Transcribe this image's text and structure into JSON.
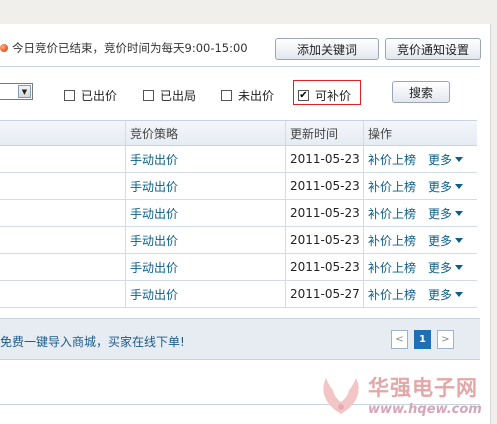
{
  "notice": {
    "text": "今日竞价已结束，竞价时间为每天9:00-15:00"
  },
  "toolbar": {
    "add_keyword_label": "添加关键词",
    "bid_notify_label": "竞价通知设置"
  },
  "filters": {
    "options": [
      {
        "label": "已出价",
        "checked": false
      },
      {
        "label": "已出局",
        "checked": false
      },
      {
        "label": "未出价",
        "checked": false
      },
      {
        "label": "可补价",
        "checked": true
      }
    ],
    "search_label": "搜索"
  },
  "table": {
    "headers": [
      "竞价策略",
      "更新时间",
      "操作"
    ],
    "rows": [
      {
        "strategy": "手动出价",
        "updated": "2011-05-23",
        "action": "补价上榜",
        "more": "更多"
      },
      {
        "strategy": "手动出价",
        "updated": "2011-05-23",
        "action": "补价上榜",
        "more": "更多"
      },
      {
        "strategy": "手动出价",
        "updated": "2011-05-23",
        "action": "补价上榜",
        "more": "更多"
      },
      {
        "strategy": "手动出价",
        "updated": "2011-05-23",
        "action": "补价上榜",
        "more": "更多"
      },
      {
        "strategy": "手动出价",
        "updated": "2011-05-23",
        "action": "补价上榜",
        "more": "更多"
      },
      {
        "strategy": "手动出价",
        "updated": "2011-05-27",
        "action": "补价上榜",
        "more": "更多"
      }
    ]
  },
  "footer": {
    "promo": "免费一键导入商城，买家在线下单!",
    "pagination": {
      "prev": "<",
      "current": "1",
      "next": ">"
    }
  },
  "watermark": {
    "name": "华强电子网",
    "url": "www.hqew.com"
  },
  "colors": {
    "link": "#0b5f8a",
    "highlight_border": "#dd2222",
    "page_active": "#1f6fb5"
  }
}
